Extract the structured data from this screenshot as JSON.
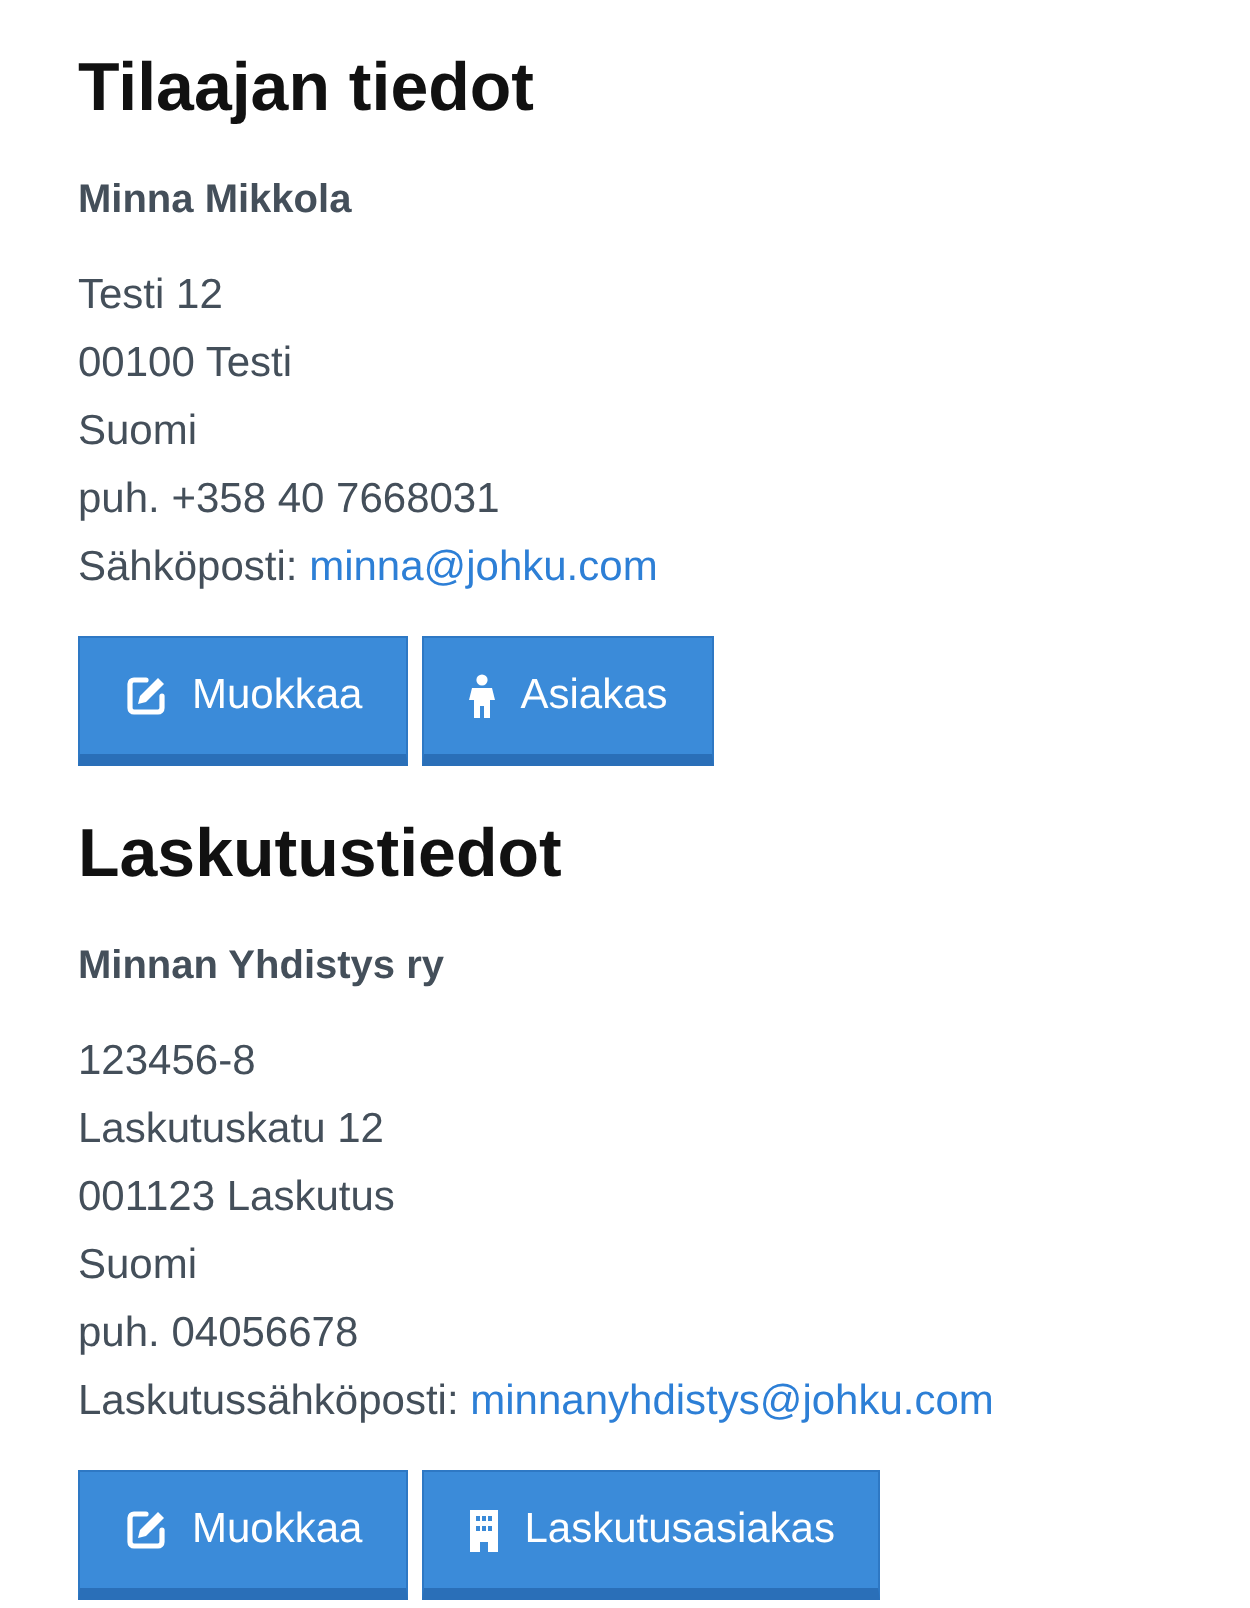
{
  "sections": [
    {
      "title": "Tilaajan tiedot",
      "name": "Minna Mikkola",
      "lines": [
        {
          "kind": "text",
          "text": "Testi 12"
        },
        {
          "kind": "text",
          "text": "00100 Testi"
        },
        {
          "kind": "text",
          "text": "Suomi"
        },
        {
          "kind": "text",
          "text": "puh. +358 40 7668031"
        },
        {
          "kind": "email",
          "label": "Sähköposti:",
          "link": "minna@johku.com"
        }
      ],
      "buttons": [
        {
          "kind": "edit",
          "label": "Muokkaa"
        },
        {
          "kind": "person",
          "label": "Asiakas"
        }
      ]
    },
    {
      "title": "Laskutustiedot",
      "name": "Minnan Yhdistys ry",
      "lines": [
        {
          "kind": "text",
          "text": "123456-8"
        },
        {
          "kind": "text",
          "text": "Laskutuskatu 12"
        },
        {
          "kind": "text",
          "text": "001123 Laskutus"
        },
        {
          "kind": "text",
          "text": "Suomi"
        },
        {
          "kind": "text",
          "text": "puh. 04056678"
        },
        {
          "kind": "email",
          "label": "Laskutussähköposti:",
          "link": "minnanyhdistys@johku.com"
        }
      ],
      "buttons": [
        {
          "kind": "edit",
          "label": "Muokkaa"
        },
        {
          "kind": "building",
          "label": "Laskutusasiakas"
        }
      ]
    }
  ]
}
